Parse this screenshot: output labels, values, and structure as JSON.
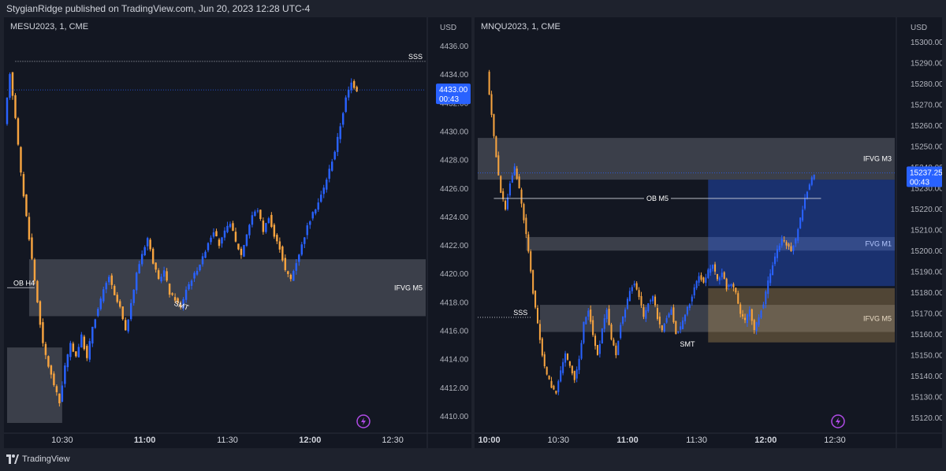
{
  "header": {
    "text": "StygianRidge published on TradingView.com, Jun 20, 2023 12:28 UTC-4"
  },
  "footer": {
    "brand": "TradingView"
  },
  "colors": {
    "up": "#2962ff",
    "down": "#f7a440",
    "bg": "#131722",
    "zone": "#5d606b",
    "label": "#2962ff"
  },
  "chart_data": [
    {
      "type": "candlestick",
      "symbol_label": "MESU2023, 1, CME",
      "currency": "USD",
      "y_ticks": [
        "4436.00",
        "4434.00",
        "4432.00",
        "4430.00",
        "4428.00",
        "4426.00",
        "4424.00",
        "4422.00",
        "4420.00",
        "4418.00",
        "4416.00",
        "4414.00",
        "4412.00",
        "4410.00"
      ],
      "ylim": [
        4409.0,
        4437.0
      ],
      "x_ticks": [
        {
          "label": "10:30",
          "bold": false,
          "t": 30
        },
        {
          "label": "11:00",
          "bold": true,
          "t": 60
        },
        {
          "label": "11:30",
          "bold": false,
          "t": 90
        },
        {
          "label": "12:00",
          "bold": true,
          "t": 120
        },
        {
          "label": "12:30",
          "bold": false,
          "t": 150
        }
      ],
      "t_range": [
        10,
        162
      ],
      "last_price": "4433.00",
      "countdown": "00:43",
      "last_value": 4432.9,
      "hlines": [
        {
          "label": "SSS",
          "value": 4434.9,
          "t0": 13,
          "t1": 162,
          "style": "dotted"
        },
        {
          "label": "OB H4",
          "value": 4419.0,
          "t0": 10,
          "t1": 20,
          "style": "solid"
        }
      ],
      "zones": [
        {
          "label": "IFVG M5",
          "y0": 4417.0,
          "y1": 4421.0,
          "t0": 18,
          "t1": 162
        },
        {
          "label": "",
          "y0": 4409.5,
          "y1": 4414.8,
          "t0": 10,
          "t1": 30
        }
      ],
      "annotations": [
        {
          "label": "SMT",
          "t": 73,
          "value": 4417.6
        }
      ],
      "path": [
        [
          10,
          4430.4
        ],
        [
          12,
          4434.1
        ],
        [
          14,
          4431.0
        ],
        [
          16,
          4427.0
        ],
        [
          18,
          4424.0
        ],
        [
          20,
          4421.0
        ],
        [
          22,
          4418.0
        ],
        [
          24,
          4415.0
        ],
        [
          26,
          4413.5
        ],
        [
          28,
          4412.2
        ],
        [
          30,
          4410.9
        ],
        [
          32,
          4413.5
        ],
        [
          34,
          4415.0
        ],
        [
          36,
          4414.2
        ],
        [
          38,
          4415.6
        ],
        [
          40,
          4414.0
        ],
        [
          42,
          4416.3
        ],
        [
          44,
          4417.5
        ],
        [
          46,
          4418.8
        ],
        [
          48,
          4419.8
        ],
        [
          50,
          4418.4
        ],
        [
          52,
          4417.6
        ],
        [
          54,
          4415.9
        ],
        [
          56,
          4417.8
        ],
        [
          58,
          4420.0
        ],
        [
          60,
          4421.4
        ],
        [
          62,
          4422.5
        ],
        [
          64,
          4420.8
        ],
        [
          66,
          4419.5
        ],
        [
          68,
          4420.2
        ],
        [
          70,
          4418.6
        ],
        [
          72,
          4418.2
        ],
        [
          74,
          4417.6
        ],
        [
          76,
          4418.9
        ],
        [
          78,
          4419.6
        ],
        [
          80,
          4420.3
        ],
        [
          82,
          4421.1
        ],
        [
          84,
          4422.2
        ],
        [
          86,
          4423.0
        ],
        [
          88,
          4422.0
        ],
        [
          90,
          4422.9
        ],
        [
          92,
          4423.6
        ],
        [
          94,
          4422.2
        ],
        [
          96,
          4421.3
        ],
        [
          98,
          4422.8
        ],
        [
          100,
          4424.1
        ],
        [
          102,
          4424.5
        ],
        [
          104,
          4423.0
        ],
        [
          106,
          4424.0
        ],
        [
          108,
          4422.6
        ],
        [
          110,
          4421.8
        ],
        [
          112,
          4420.2
        ],
        [
          114,
          4419.6
        ],
        [
          116,
          4420.8
        ],
        [
          118,
          4422.0
        ],
        [
          120,
          4423.3
        ],
        [
          122,
          4424.2
        ],
        [
          124,
          4425.0
        ],
        [
          126,
          4426.0
        ],
        [
          128,
          4427.3
        ],
        [
          130,
          4428.6
        ],
        [
          132,
          4430.4
        ],
        [
          134,
          4432.3
        ],
        [
          136,
          4433.4
        ],
        [
          138,
          4432.9
        ]
      ]
    },
    {
      "type": "candlestick",
      "symbol_label": "MNQU2023, 1, CME",
      "currency": "USD",
      "y_ticks": [
        "15300.00",
        "15290.00",
        "15280.00",
        "15270.00",
        "15260.00",
        "15250.00",
        "15240.00",
        "15230.00",
        "15220.00",
        "15210.00",
        "15200.00",
        "15190.00",
        "15180.00",
        "15170.00",
        "15160.00",
        "15150.00",
        "15140.00",
        "15130.00",
        "15120.00"
      ],
      "ylim": [
        15114.0,
        15305.0
      ],
      "x_ticks": [
        {
          "label": "10:00",
          "bold": true,
          "t": 0
        },
        {
          "label": "10:30",
          "bold": false,
          "t": 30
        },
        {
          "label": "11:00",
          "bold": true,
          "t": 60
        },
        {
          "label": "11:30",
          "bold": false,
          "t": 90
        },
        {
          "label": "12:00",
          "bold": true,
          "t": 120
        },
        {
          "label": "12:30",
          "bold": false,
          "t": 150
        }
      ],
      "t_range": [
        -5,
        176
      ],
      "last_price": "15237.25",
      "countdown": "00:43",
      "last_value": 15237.3,
      "hlines": [
        {
          "label": "OB M5",
          "value": 15225.0,
          "t0": 2,
          "t1": 144,
          "style": "solid"
        },
        {
          "label": "SSS",
          "value": 15168.0,
          "t0": -5,
          "t1": 18,
          "style": "dotted"
        }
      ],
      "zones": [
        {
          "label": "IFVG M3",
          "y0": 15234.0,
          "y1": 15254.0,
          "t0": -5,
          "t1": 176
        },
        {
          "label": "FVG M1",
          "y0": 15200.0,
          "y1": 15206.5,
          "t0": 16,
          "t1": 176
        },
        {
          "label": "IFVG M5",
          "y0": 15161.0,
          "y1": 15174.0,
          "t0": 22,
          "t1": 176
        }
      ],
      "blue_box": {
        "y0": 15183.0,
        "y1": 15234.0,
        "t0": 95,
        "t1": 176
      },
      "tan_box": {
        "y0": 15156.0,
        "y1": 15182.0,
        "t0": 95,
        "t1": 176
      },
      "annotations": [
        {
          "label": "SMT",
          "t": 86,
          "value": 15154.0
        }
      ],
      "path": [
        [
          0,
          15285
        ],
        [
          2,
          15265
        ],
        [
          4,
          15245
        ],
        [
          6,
          15228
        ],
        [
          8,
          15220
        ],
        [
          10,
          15232
        ],
        [
          12,
          15240
        ],
        [
          14,
          15230
        ],
        [
          16,
          15215
        ],
        [
          18,
          15200
        ],
        [
          20,
          15180
        ],
        [
          22,
          15165
        ],
        [
          24,
          15150
        ],
        [
          26,
          15140
        ],
        [
          28,
          15135
        ],
        [
          30,
          15132
        ],
        [
          32,
          15142
        ],
        [
          34,
          15150
        ],
        [
          36,
          15145
        ],
        [
          38,
          15138
        ],
        [
          40,
          15148
        ],
        [
          42,
          15165
        ],
        [
          44,
          15172
        ],
        [
          46,
          15160
        ],
        [
          48,
          15150
        ],
        [
          50,
          15162
        ],
        [
          52,
          15172
        ],
        [
          54,
          15158
        ],
        [
          56,
          15150
        ],
        [
          58,
          15165
        ],
        [
          60,
          15172
        ],
        [
          62,
          15180
        ],
        [
          64,
          15185
        ],
        [
          66,
          15178
        ],
        [
          68,
          15168
        ],
        [
          70,
          15175
        ],
        [
          72,
          15178
        ],
        [
          74,
          15168
        ],
        [
          76,
          15162
        ],
        [
          78,
          15168
        ],
        [
          80,
          15172
        ],
        [
          82,
          15160
        ],
        [
          84,
          15163
        ],
        [
          86,
          15170
        ],
        [
          88,
          15175
        ],
        [
          90,
          15182
        ],
        [
          92,
          15188
        ],
        [
          94,
          15185
        ],
        [
          96,
          15190
        ],
        [
          98,
          15193
        ],
        [
          100,
          15186
        ],
        [
          102,
          15190
        ],
        [
          104,
          15182
        ],
        [
          106,
          15184
        ],
        [
          108,
          15180
        ],
        [
          110,
          15170
        ],
        [
          112,
          15166
        ],
        [
          114,
          15172
        ],
        [
          116,
          15162
        ],
        [
          118,
          15168
        ],
        [
          120,
          15175
        ],
        [
          122,
          15185
        ],
        [
          124,
          15193
        ],
        [
          126,
          15200
        ],
        [
          128,
          15205
        ],
        [
          130,
          15203
        ],
        [
          132,
          15200
        ],
        [
          134,
          15205
        ],
        [
          136,
          15215
        ],
        [
          138,
          15225
        ],
        [
          140,
          15232
        ],
        [
          142,
          15237
        ]
      ]
    }
  ]
}
